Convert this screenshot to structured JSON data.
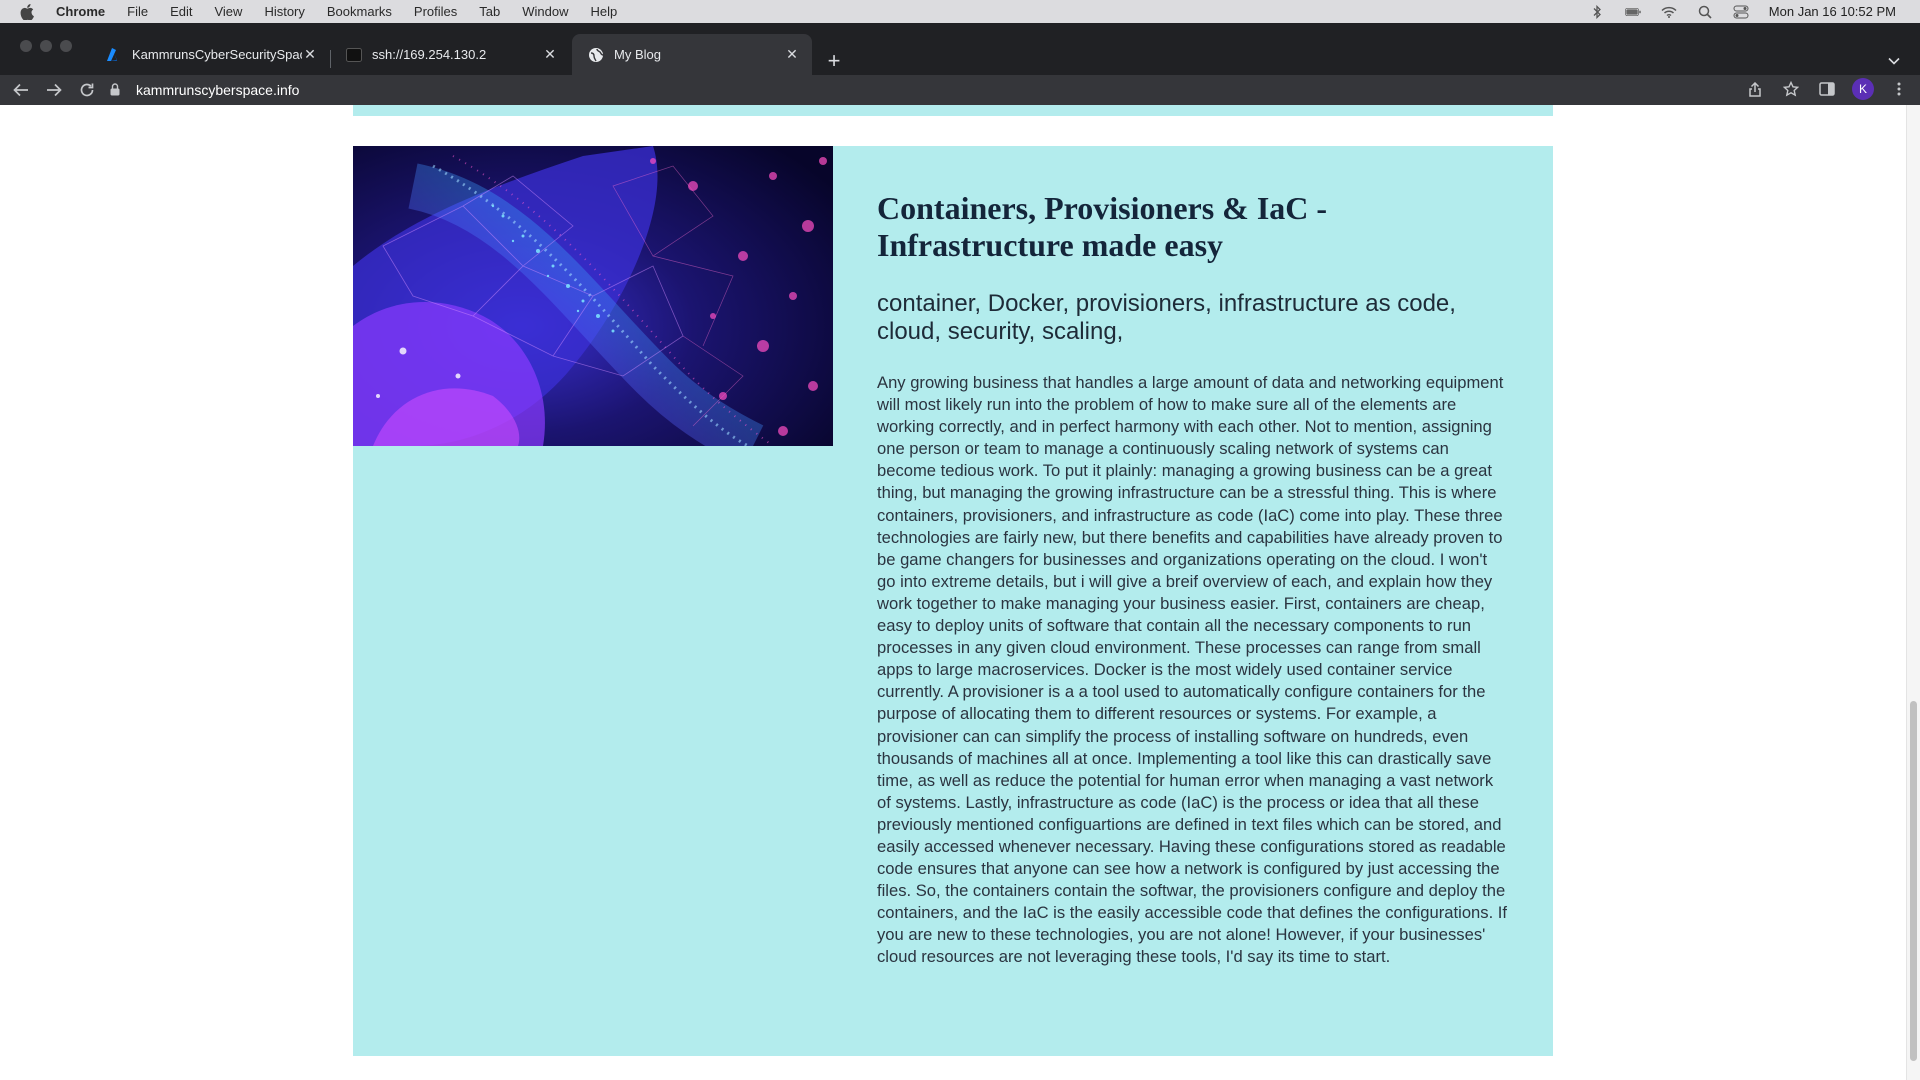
{
  "menubar": {
    "app_name": "Chrome",
    "items": [
      "File",
      "Edit",
      "View",
      "History",
      "Bookmarks",
      "Profiles",
      "Tab",
      "Window",
      "Help"
    ],
    "clock": "Mon Jan 16  10:52 PM"
  },
  "tabs": [
    {
      "title": "KammrunsCyberSecuritySpace",
      "icon": "azure-icon"
    },
    {
      "title": "ssh://169.254.130.2",
      "icon": "terminal-icon"
    },
    {
      "title": "My Blog",
      "icon": "globe-icon",
      "active": true
    }
  ],
  "toolbar": {
    "url": "kammrunscyberspace.info",
    "profile_initial": "K"
  },
  "post": {
    "title": "Containers, Provisioners & IaC - Infrastructure made easy",
    "tags": "container, Docker, provisioners, infrastructure as code, cloud, security, scaling,",
    "body": "Any growing business that handles a large amount of data and networking equipment will most likely run into the problem of how to make sure all of the elements are working correctly, and in perfect harmony with each other. Not to mention, assigning one person or team to manage a continuously scaling network of systems can become tedious work. To put it plainly: managing a growing business can be a great thing, but managing the growing infrastructure can be a stressful thing. This is where containers, provisioners, and infrastructure as code (IaC) come into play. These three technologies are fairly new, but there benefits and capabilities have already proven to be game changers for businesses and organizations operating on the cloud. I won't go into extreme details, but i will give a breif overview of each, and explain how they work together to make managing your business easier. First, containers are cheap, easy to deploy units of software that contain all the necessary components to run processes in any given cloud environment. These processes can range from small apps to large macroservices. Docker is the most widely used container service currently. A provisioner is a a tool used to automatically configure containers for the purpose of allocating them to different resources or systems. For example, a provisioner can can simplify the process of installing software on hundreds, even thousands of machines all at once. Implementing a tool like this can drastically save time, as well as reduce the potential for human error when managing a vast network of systems. Lastly, infrastructure as code (IaC) is the process or idea that all these previously mentioned configuartions are defined in text files which can be stored, and easily accessed whenever necessary. Having these configurations stored as readable code ensures that anyone can see how a network is configured by just accessing the files. So, the containers contain the softwar, the provisioners configure and deploy the containers, and the IaC is the easily accessible code that defines the configurations. If you are new to these technologies, you are not alone! However, if your businesses' cloud resources are not leveraging these tools, I'd say its time to start."
  },
  "colors": {
    "card_background": "#b3eced",
    "title_color": "#14253a",
    "chrome_dark": "#202124",
    "avatar": "#5b2fb5"
  }
}
